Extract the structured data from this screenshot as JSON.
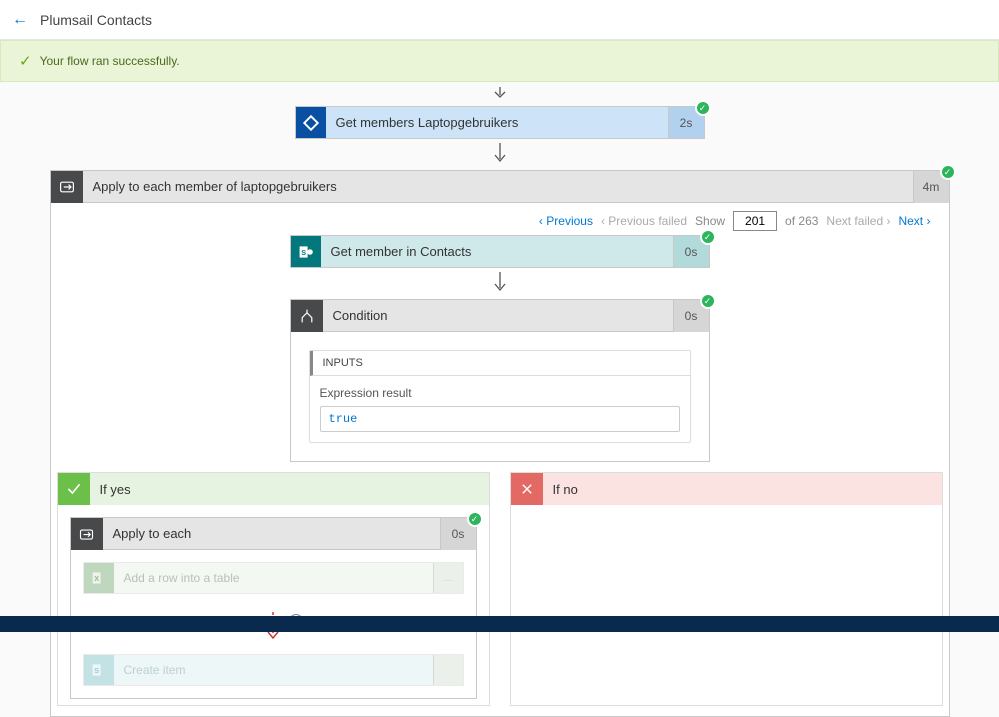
{
  "header": {
    "title": "Plumsail Contacts"
  },
  "banner": {
    "message": "Your flow ran successfully."
  },
  "step1": {
    "title": "Get members Laptopgebruikers",
    "duration": "2s"
  },
  "loop": {
    "title": "Apply to each member of laptopgebruikers",
    "duration": "4m",
    "nav": {
      "previous": "Previous",
      "previous_failed": "Previous failed",
      "show": "Show",
      "current": "201",
      "of": "of 263",
      "next_failed": "Next failed",
      "next": "Next"
    }
  },
  "step2": {
    "title": "Get member in Contacts",
    "duration": "0s"
  },
  "condition": {
    "title": "Condition",
    "duration": "0s",
    "inputs_label": "INPUTS",
    "expression_label": "Expression result",
    "expression_value": "true"
  },
  "branch_yes": {
    "title": "If yes"
  },
  "branch_no": {
    "title": "If no"
  },
  "inner_loop": {
    "title": "Apply to each",
    "duration": "0s"
  },
  "faded1": {
    "title": "Add a row into a table",
    "duration": "..."
  },
  "faded2": {
    "title": "Create item",
    "duration": ""
  }
}
